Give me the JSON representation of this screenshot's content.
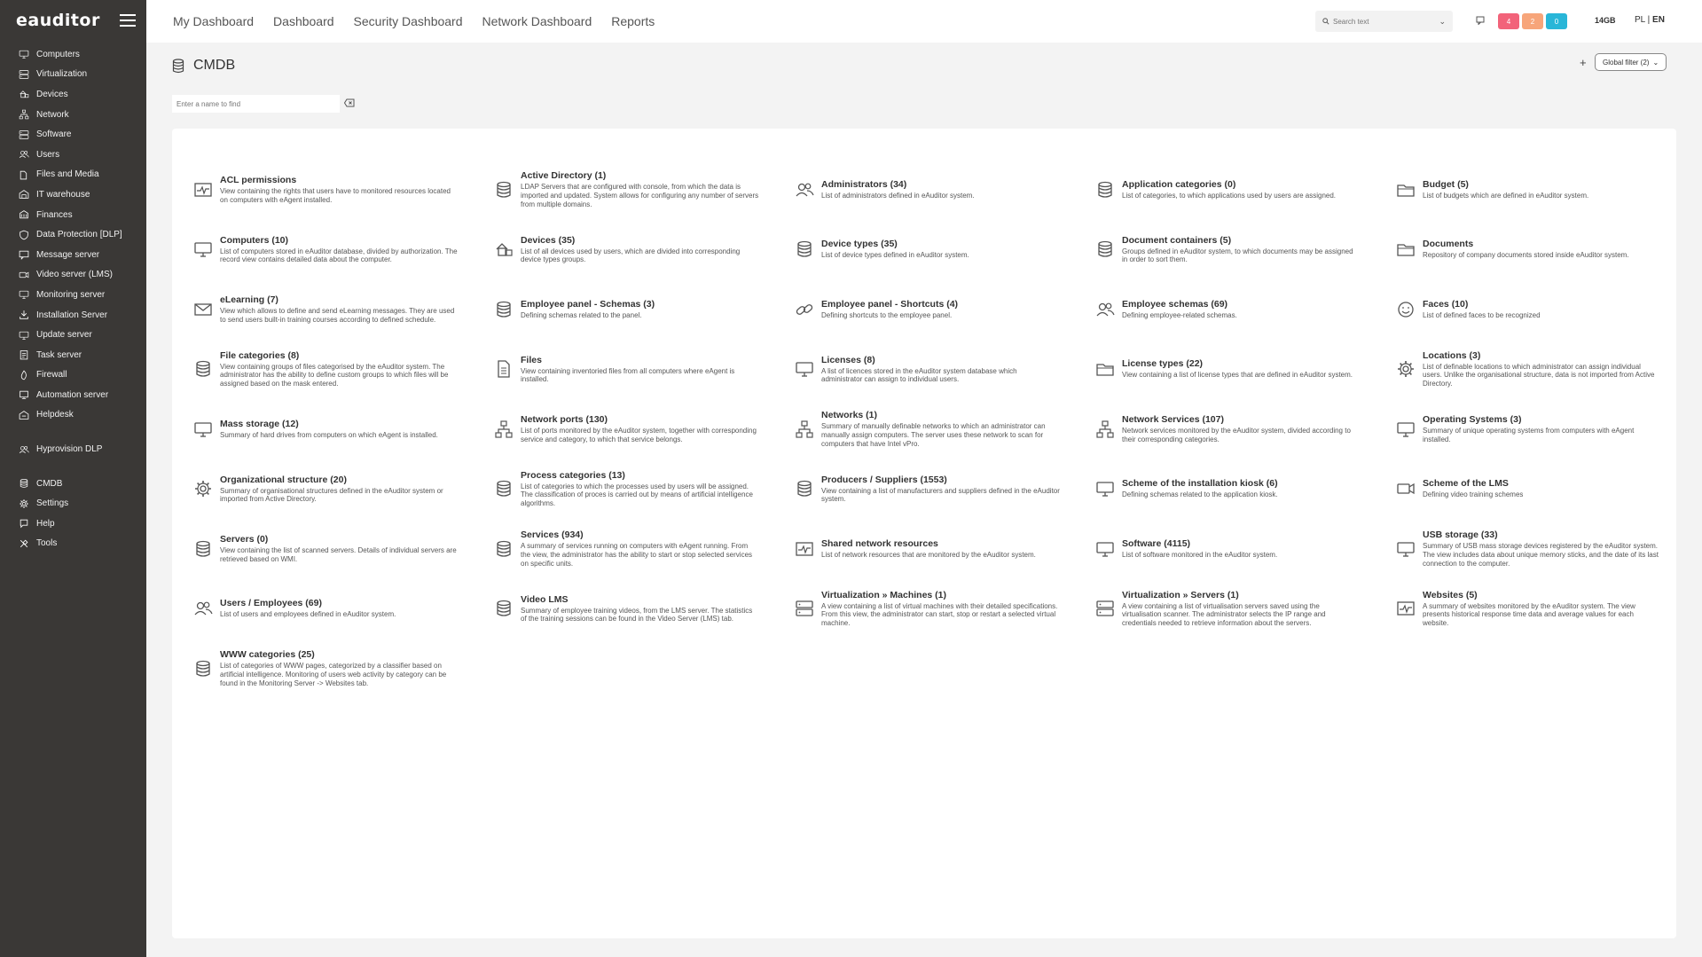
{
  "app": {
    "logo": "eauditor"
  },
  "sidebar": {
    "items": [
      {
        "label": "Computers",
        "icon": "monitor-icon"
      },
      {
        "label": "Virtualization",
        "icon": "server-icon"
      },
      {
        "label": "Devices",
        "icon": "devices-icon"
      },
      {
        "label": "Network",
        "icon": "network-icon"
      },
      {
        "label": "Software",
        "icon": "server-icon"
      },
      {
        "label": "Users",
        "icon": "users-icon"
      },
      {
        "label": "Files and Media",
        "icon": "files-icon"
      },
      {
        "label": "IT warehouse",
        "icon": "warehouse-icon"
      },
      {
        "label": "Finances",
        "icon": "finances-icon"
      },
      {
        "label": "Data Protection [DLP]",
        "icon": "shield-icon"
      },
      {
        "label": "Message server",
        "icon": "message-icon"
      },
      {
        "label": "Video server (LMS)",
        "icon": "video-icon"
      },
      {
        "label": "Monitoring server",
        "icon": "monitor-icon"
      },
      {
        "label": "Installation Server",
        "icon": "install-icon"
      },
      {
        "label": "Update server",
        "icon": "monitor-icon"
      },
      {
        "label": "Task server",
        "icon": "task-icon"
      },
      {
        "label": "Firewall",
        "icon": "firewall-icon"
      },
      {
        "label": "Automation server",
        "icon": "automation-icon"
      },
      {
        "label": "Helpdesk",
        "icon": "helpdesk-icon"
      }
    ],
    "items2": [
      {
        "label": "Hyprovision DLP",
        "icon": "users-icon"
      }
    ],
    "items3": [
      {
        "label": "CMDB",
        "icon": "database-icon"
      },
      {
        "label": "Settings",
        "icon": "gear-icon"
      },
      {
        "label": "Help",
        "icon": "help-icon"
      },
      {
        "label": "Tools",
        "icon": "tools-icon"
      }
    ]
  },
  "topnav": [
    "My Dashboard",
    "Dashboard",
    "Security Dashboard",
    "Network Dashboard",
    "Reports"
  ],
  "search": {
    "placeholder": "Search text"
  },
  "badges": [
    {
      "value": "4",
      "color": "#f2637a"
    },
    {
      "value": "2",
      "color": "#f7a57a"
    },
    {
      "value": "0",
      "color": "#29b6d8"
    }
  ],
  "memory": "14GB",
  "lang": {
    "pl": "PL",
    "sep": "|",
    "en": "EN"
  },
  "page": {
    "title": "CMDB",
    "plus": "+",
    "global_filter": "Global filter (2)",
    "find_placeholder": "Enter a name to find"
  },
  "items": [
    {
      "title": "ACL permissions",
      "desc": "View containing the rights that users have to monitored resources located on computers with eAgent installed.",
      "icon": "chart-icon"
    },
    {
      "title": "Active Directory (1)",
      "desc": "LDAP Servers that are configured with console, from which the data is imported and updated. System allows for configuring any number of servers from multiple domains.",
      "icon": "database-icon"
    },
    {
      "title": "Administrators (34)",
      "desc": "List of administrators defined in eAuditor system.",
      "icon": "users-icon"
    },
    {
      "title": "Application categories (0)",
      "desc": "List of categories, to which applications used by users are assigned.",
      "icon": "database-icon"
    },
    {
      "title": "Budget (5)",
      "desc": "List of budgets which are defined in eAuditor system.",
      "icon": "folder-icon"
    },
    {
      "title": "Computers (10)",
      "desc": "List of computers stored in eAuditor database, divided by authorization. The record view contains detailed data about the computer.",
      "icon": "monitor-icon"
    },
    {
      "title": "Devices (35)",
      "desc": "List of all devices used by users, which are divided into corresponding device types groups.",
      "icon": "devices-icon"
    },
    {
      "title": "Device types (35)",
      "desc": "List of device types defined in eAuditor system.",
      "icon": "database-icon"
    },
    {
      "title": "Document containers (5)",
      "desc": "Groups defined in eAuditor system, to which documents may be assigned in order to sort them.",
      "icon": "database-icon"
    },
    {
      "title": "Documents",
      "desc": "Repository of company documents stored inside eAuditor system.",
      "icon": "folder-icon"
    },
    {
      "title": "eLearning (7)",
      "desc": "View which allows to define and send eLearning messages. They are used to send users built-in training courses according to defined schedule.",
      "icon": "mail-icon"
    },
    {
      "title": "Employee panel - Schemas (3)",
      "desc": "Defining schemas related to the panel.",
      "icon": "database-icon"
    },
    {
      "title": "Employee panel - Shortcuts (4)",
      "desc": "Defining shortcuts to the employee panel.",
      "icon": "link-icon"
    },
    {
      "title": "Employee schemas (69)",
      "desc": "Defining employee-related schemas.",
      "icon": "users-icon"
    },
    {
      "title": "Faces (10)",
      "desc": "List of defined faces to be recognized",
      "icon": "smile-icon"
    },
    {
      "title": "File categories (8)",
      "desc": "View containing groups of files categorised by the eAuditor system. The administrator has the ability to define custom groups to which files will be assigned based on the mask entered.",
      "icon": "database-icon"
    },
    {
      "title": "Files",
      "desc": "View containing inventoried files from all computers where eAgent is installed.",
      "icon": "file-icon"
    },
    {
      "title": "Licenses (8)",
      "desc": "A list of licences stored in the eAuditor system database which administrator can assign to individual users.",
      "icon": "monitor-icon"
    },
    {
      "title": "License types (22)",
      "desc": "View containing a list of license types that are defined in eAuditor system.",
      "icon": "folder-icon"
    },
    {
      "title": "Locations (3)",
      "desc": "List of definable locations to which administrator can assign individual users. Unlike the organisational structure, data is not imported from Active Directory.",
      "icon": "gear-icon"
    },
    {
      "title": "Mass storage (12)",
      "desc": "Summary of hard drives from computers on which eAgent is installed.",
      "icon": "monitor-icon"
    },
    {
      "title": "Network ports (130)",
      "desc": "List of ports monitored by the eAuditor system, together with corresponding service and category, to which that service belongs.",
      "icon": "network-icon"
    },
    {
      "title": "Networks (1)",
      "desc": "Summary of manually definable networks to which an administrator can manually assign computers. The server uses these network to scan for computers that have Intel vPro.",
      "icon": "network-icon"
    },
    {
      "title": "Network Services (107)",
      "desc": "Network services monitored by the eAuditor system, divided according to their corresponding categories.",
      "icon": "network-icon"
    },
    {
      "title": "Operating Systems (3)",
      "desc": "Summary of unique operating systems from computers with eAgent installed.",
      "icon": "monitor-icon"
    },
    {
      "title": "Organizational structure (20)",
      "desc": "Summary of organisational structures defined in the eAuditor system or imported from Active Directory.",
      "icon": "gear-icon"
    },
    {
      "title": "Process categories (13)",
      "desc": "List of categories to which the processes used by users will be assigned. The classification of proces is carried out by means of artificial intelligence algorithms.",
      "icon": "database-icon"
    },
    {
      "title": "Producers / Suppliers (1553)",
      "desc": "View containing a list of manufacturers and suppliers defined in the eAuditor system.",
      "icon": "database-icon"
    },
    {
      "title": "Scheme of the installation kiosk (6)",
      "desc": "Defining schemas related to the application kiosk.",
      "icon": "monitor-icon"
    },
    {
      "title": "Scheme of the LMS",
      "desc": "Defining video training schemes",
      "icon": "video-icon"
    },
    {
      "title": "Servers (0)",
      "desc": "View containing the list of scanned servers. Details of individual servers are retrieved based on WMI.",
      "icon": "database-icon"
    },
    {
      "title": "Services (934)",
      "desc": "A summary of services running on computers with eAgent running. From the view, the administrator has the ability to start or stop selected services on specific units.",
      "icon": "database-icon"
    },
    {
      "title": "Shared network resources",
      "desc": "List of network resources that are monitored by the eAuditor system.",
      "icon": "chart-icon"
    },
    {
      "title": "Software (4115)",
      "desc": "List of software monitored in the eAuditor system.",
      "icon": "monitor-icon"
    },
    {
      "title": "USB storage (33)",
      "desc": "Summary of USB mass storage devices registered by the eAuditor system. The view includes data about unique memory sticks, and the date of its last connection to the computer.",
      "icon": "monitor-icon"
    },
    {
      "title": "Users / Employees (69)",
      "desc": "List of users and employees defined in eAuditor system.",
      "icon": "users-icon"
    },
    {
      "title": "Video LMS",
      "desc": "Summary of employee training videos, from the LMS server. The statistics of the training sessions can be found in the Video Server (LMS) tab.",
      "icon": "database-icon"
    },
    {
      "title": "Virtualization » Machines (1)",
      "desc": "A view containing a list of virtual machines with their detailed specifications. From this view, the administrator can start, stop or restart a selected virtual machine.",
      "icon": "server-icon"
    },
    {
      "title": "Virtualization » Servers (1)",
      "desc": "A view containing a list of virtualisation servers saved using the virtualisation scanner. The administrator selects the IP range and credentials needed to retrieve information about the servers.",
      "icon": "server-icon"
    },
    {
      "title": "Websites (5)",
      "desc": "A summary of websites monitored by the eAuditor system. The view presents historical response time data and average values for each website.",
      "icon": "chart-icon"
    },
    {
      "title": "WWW categories (25)",
      "desc": "List of categories of WWW pages, categorized by a classifier based on artificial intelligence. Monitoring of users web activity by category can be found in the Monitoring Server -> Websites tab.",
      "icon": "database-icon"
    }
  ]
}
